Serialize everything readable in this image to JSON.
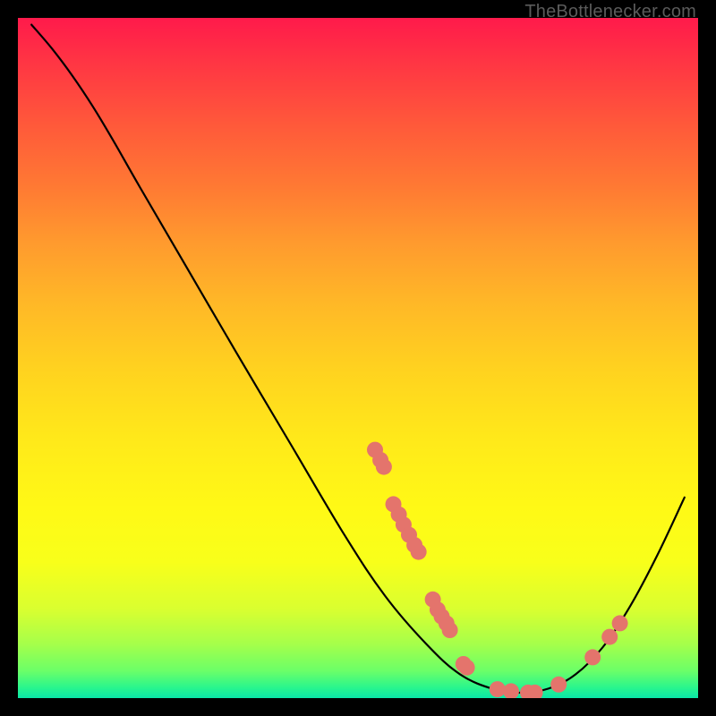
{
  "watermark": "TheBottlenecker.com",
  "chart_data": {
    "type": "line",
    "title": "",
    "xlabel": "",
    "ylabel": "",
    "xlim": [
      0,
      100
    ],
    "ylim": [
      0,
      100
    ],
    "grid": false,
    "line": {
      "name": "curve",
      "color": "#000000",
      "points": [
        {
          "x": 2.0,
          "y": 99.0
        },
        {
          "x": 5.0,
          "y": 95.5
        },
        {
          "x": 8.0,
          "y": 91.5
        },
        {
          "x": 11.0,
          "y": 87.0
        },
        {
          "x": 14.0,
          "y": 82.0
        },
        {
          "x": 18.0,
          "y": 75.0
        },
        {
          "x": 25.0,
          "y": 63.0
        },
        {
          "x": 32.0,
          "y": 51.0
        },
        {
          "x": 40.0,
          "y": 37.5
        },
        {
          "x": 48.0,
          "y": 24.0
        },
        {
          "x": 54.0,
          "y": 15.0
        },
        {
          "x": 60.0,
          "y": 8.0
        },
        {
          "x": 65.0,
          "y": 3.5
        },
        {
          "x": 70.0,
          "y": 1.3
        },
        {
          "x": 74.0,
          "y": 0.8
        },
        {
          "x": 78.0,
          "y": 1.4
        },
        {
          "x": 82.0,
          "y": 3.5
        },
        {
          "x": 86.0,
          "y": 7.5
        },
        {
          "x": 90.0,
          "y": 13.5
        },
        {
          "x": 94.0,
          "y": 21.0
        },
        {
          "x": 98.0,
          "y": 29.5
        }
      ]
    },
    "markers": {
      "name": "data-points",
      "color": "#e4746c",
      "radius": 9,
      "points": [
        {
          "x": 52.5,
          "y": 36.5
        },
        {
          "x": 53.3,
          "y": 35.0
        },
        {
          "x": 53.8,
          "y": 34.0
        },
        {
          "x": 55.2,
          "y": 28.5
        },
        {
          "x": 56.0,
          "y": 27.0
        },
        {
          "x": 56.7,
          "y": 25.5
        },
        {
          "x": 57.5,
          "y": 24.0
        },
        {
          "x": 58.3,
          "y": 22.5
        },
        {
          "x": 58.9,
          "y": 21.5
        },
        {
          "x": 61.0,
          "y": 14.5
        },
        {
          "x": 61.7,
          "y": 13.0
        },
        {
          "x": 62.3,
          "y": 12.0
        },
        {
          "x": 63.0,
          "y": 11.0
        },
        {
          "x": 63.5,
          "y": 10.0
        },
        {
          "x": 65.5,
          "y": 5.0
        },
        {
          "x": 66.0,
          "y": 4.5
        },
        {
          "x": 70.5,
          "y": 1.3
        },
        {
          "x": 72.5,
          "y": 1.0
        },
        {
          "x": 75.0,
          "y": 0.8
        },
        {
          "x": 76.0,
          "y": 0.8
        },
        {
          "x": 79.5,
          "y": 2.0
        },
        {
          "x": 84.5,
          "y": 6.0
        },
        {
          "x": 87.0,
          "y": 9.0
        },
        {
          "x": 88.5,
          "y": 11.0
        }
      ]
    }
  }
}
